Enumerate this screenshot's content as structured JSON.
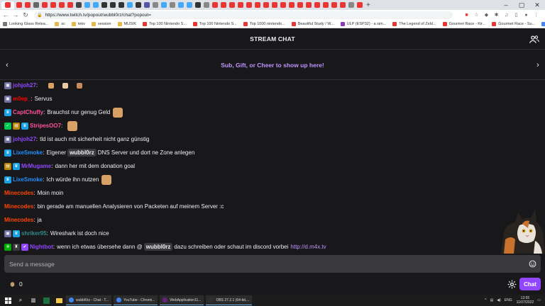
{
  "browser": {
    "url": "https://www.twitch.tv/popout/wubbl0rz/chat?popout=",
    "tab_favicon_colors": [
      "#e33",
      "#e33",
      "#e33",
      "#666",
      "#e33",
      "#e33",
      "#e33",
      "#e33",
      "#444",
      "#4af",
      "#4af",
      "#333",
      "#333",
      "#333",
      "#4af",
      "#333",
      "#55a",
      "#888",
      "#4af",
      "#888",
      "#4af",
      "#4af",
      "#333",
      "#888",
      "#e33",
      "#e33",
      "#e33",
      "#e33",
      "#e33",
      "#e33",
      "#e33",
      "#e33",
      "#e33",
      "#e33",
      "#e33",
      "#e33",
      "#e33",
      "#e33",
      "#e33",
      "#e33",
      "#888",
      "#e33"
    ],
    "bookmarks": [
      {
        "label": "Looking Glass Relea...",
        "color": "#777"
      },
      {
        "label": "sc",
        "color": "#e6b84a"
      },
      {
        "label": "tekv",
        "color": "#e6b84a"
      },
      {
        "label": "session",
        "color": "#e6b84a"
      },
      {
        "label": "MUSIK",
        "color": "#e6b84a"
      },
      {
        "label": "Top 100 Nintendo S...",
        "color": "#e33"
      },
      {
        "label": "Top 100 Nintendo S...",
        "color": "#e33"
      },
      {
        "label": "Top 1000 nintendo...",
        "color": "#e33"
      },
      {
        "label": "Beautiful Study / W...",
        "color": "#e33"
      },
      {
        "label": "ULP (ESP32) - a sim...",
        "color": "#8a3ab9"
      },
      {
        "label": "The Legend of Zeld...",
        "color": "#e33"
      },
      {
        "label": "Gourmet Race - Kir...",
        "color": "#e33"
      },
      {
        "label": "Gourmet Race - Su...",
        "color": "#e33"
      },
      {
        "label": "gachibass gif - Goo...",
        "color": "#4285f4"
      }
    ]
  },
  "chat": {
    "title": "STREAM CHAT",
    "banner": "Sub, Gift, or Cheer to show up here!",
    "input_placeholder": "Send a message",
    "points": "0",
    "chat_button": "Chat",
    "colors": {
      "accent": "#9147ff",
      "link": "#bf94ff",
      "background": "#18181b"
    },
    "messages": [
      {
        "user": "johjoh27",
        "color": "#9147ff",
        "badges": [
          {
            "icon": "robot-icon",
            "color": "#6e6e9e"
          }
        ],
        "text": "",
        "emotes": 3
      },
      {
        "user": "m0ep_",
        "color": "#ff0000",
        "badges": [
          {
            "icon": "robot-icon",
            "color": "#6e6e9e"
          }
        ],
        "text": "Servus"
      },
      {
        "user": "CaptChuffy",
        "color": "#ff4f9a",
        "badges": [
          {
            "icon": "prime-crown-icon",
            "color": "#1ba1e2"
          }
        ],
        "text": "Brauchst nur genug Geld",
        "emotes": 1
      },
      {
        "user": "StripesOO7",
        "color": "#ff4f9a",
        "badges": [
          {
            "icon": "check-icon",
            "color": "#00c853"
          },
          {
            "icon": "sub-badge-icon",
            "color": "#b8860b"
          },
          {
            "icon": "prime-crown-icon",
            "color": "#1ba1e2"
          }
        ],
        "text": "",
        "emotes": 1
      },
      {
        "user": "johjoh27",
        "color": "#9147ff",
        "badges": [
          {
            "icon": "robot-icon",
            "color": "#6e6e9e"
          }
        ],
        "text": "tld ist auch mit sicherheit nicht ganz günstig"
      },
      {
        "user": "LixeSmoke",
        "color": "#1e90ff",
        "badges": [
          {
            "icon": "prime-crown-icon",
            "color": "#1ba1e2"
          }
        ],
        "pre": "Eigener",
        "mention": "wubbl0rz",
        "text": "DNS Server und dort ne Zone anlegen"
      },
      {
        "user": "MrMugame",
        "color": "#9147ff",
        "badges": [
          {
            "icon": "sub-badge-icon",
            "color": "#b8860b"
          },
          {
            "icon": "prime-crown-icon",
            "color": "#1ba1e2"
          }
        ],
        "text": "dann her mit dem donation goal"
      },
      {
        "user": "LixeSmoke",
        "color": "#1e90ff",
        "badges": [
          {
            "icon": "prime-crown-icon",
            "color": "#1ba1e2"
          }
        ],
        "text": "Ich würde ihn nutzen",
        "emotes": 1
      },
      {
        "user": "Minecodes",
        "color": "#ff4500",
        "badges": [],
        "text": "Moin moin"
      },
      {
        "user": "Minecodes",
        "color": "#ff4500",
        "badges": [],
        "text": "bin gerade am manuellen Analysieren von Packeten auf meinem Server :c"
      },
      {
        "user": "Minecodes",
        "color": "#ff4500",
        "badges": [],
        "text": "ja"
      },
      {
        "user": "shriker95",
        "color": "#2e8b8b",
        "badges": [
          {
            "icon": "robot-icon",
            "color": "#6e6e9e"
          },
          {
            "icon": "prime-crown-icon",
            "color": "#1ba1e2"
          }
        ],
        "text": "Wireshark ist doch nice"
      },
      {
        "user": "Nightbot",
        "color": "#9147ff",
        "badges": [
          {
            "icon": "gear-badge-icon",
            "color": "#00ad03"
          },
          {
            "icon": "broadcaster-icon",
            "color": "#3a3a3d"
          },
          {
            "icon": "verified-icon",
            "color": "#9147ff"
          }
        ],
        "pre": "wenn ich etwas übersehe dann @",
        "mention": "wubbl0rz",
        "text": "dazu schreiben oder schaut im discord vorbei",
        "link": "http://d.m4x.tv"
      }
    ]
  },
  "taskbar": {
    "apps": [
      {
        "label": "wubbl0rz - Chat - T...",
        "color": "#4285f4"
      },
      {
        "label": "YouTube - Chromi...",
        "color": "#4285f4"
      },
      {
        "label": "WebApplication11...",
        "color": "#68217a"
      },
      {
        "label": "OBS 27.2.1 (64-bit,...",
        "color": "#302e31"
      }
    ],
    "lang": "ENG",
    "time": "13:55",
    "date": "11/07/2022"
  }
}
